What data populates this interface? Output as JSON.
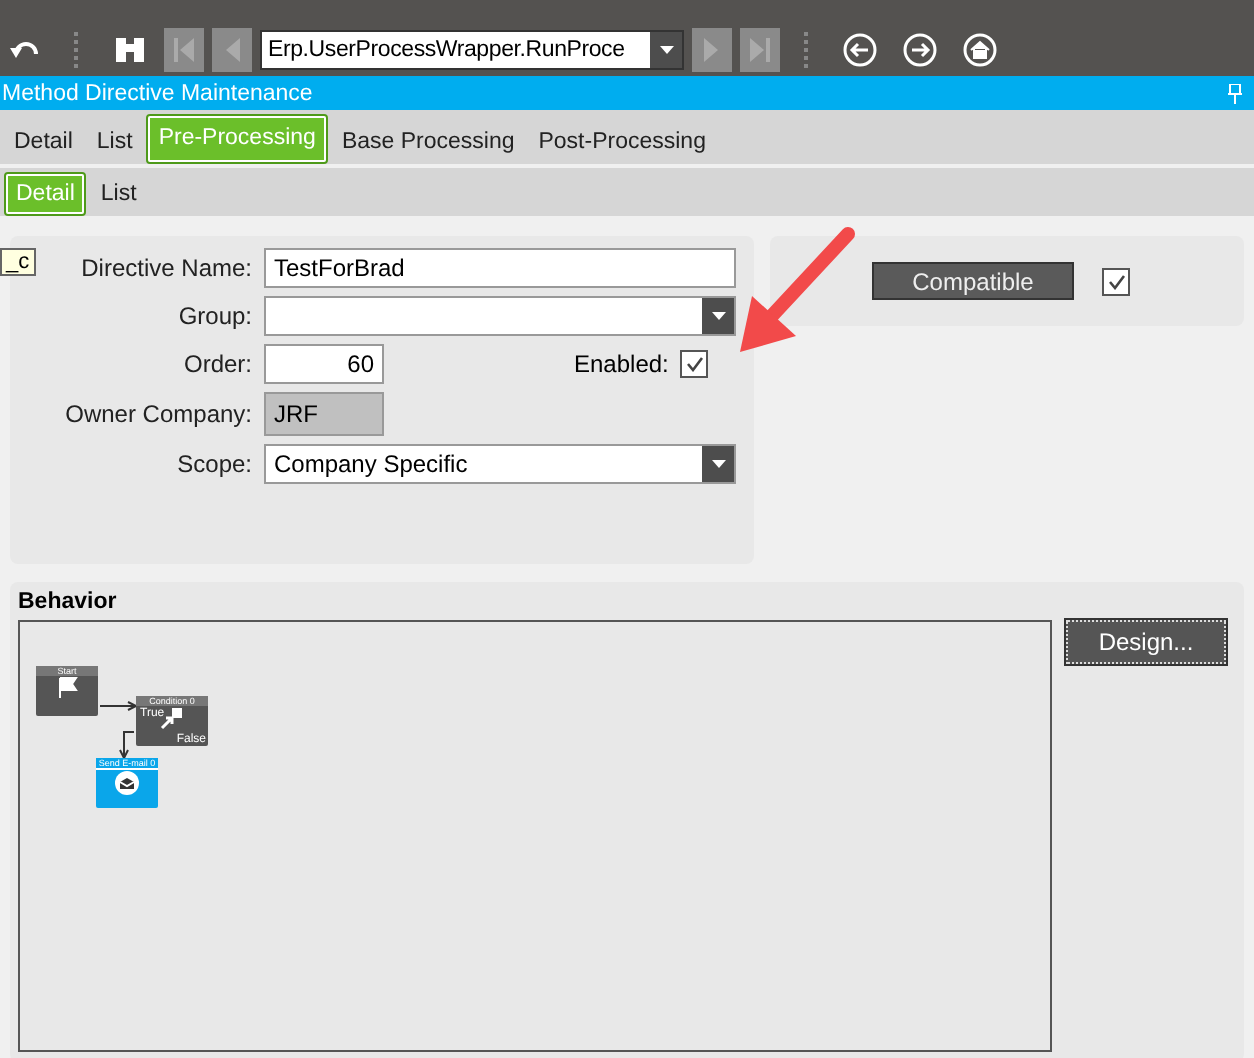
{
  "toolbar": {
    "process": "Erp.UserProcessWrapper.RunProce"
  },
  "window": {
    "title": "Method Directive Maintenance"
  },
  "tabs": [
    {
      "label": "Detail",
      "selected": false
    },
    {
      "label": "List",
      "selected": false
    },
    {
      "label": "Pre-Processing",
      "selected": true
    },
    {
      "label": "Base Processing",
      "selected": false
    },
    {
      "label": "Post-Processing",
      "selected": false
    }
  ],
  "subtabs": [
    {
      "label": "Detail",
      "selected": true
    },
    {
      "label": "List",
      "selected": false
    }
  ],
  "side_tag": "_c",
  "form": {
    "directive_name_label": "Directive Name:",
    "directive_name": "TestForBrad",
    "group_label": "Group:",
    "order_label": "Order:",
    "order": "60",
    "enabled_label": "Enabled:",
    "enabled": true,
    "owner_label": "Owner Company:",
    "owner": "JRF",
    "scope_label": "Scope:",
    "scope": "Company Specific"
  },
  "compatible": {
    "label": "Compatible",
    "checked": true
  },
  "behavior": {
    "title": "Behavior",
    "design_button": "Design...",
    "nodes": [
      {
        "kind": "start",
        "title": "Start"
      },
      {
        "kind": "condition",
        "title": "Condition 0",
        "true_label": "True",
        "false_label": "False"
      },
      {
        "kind": "email",
        "title": "Send E-mail 0"
      }
    ]
  }
}
